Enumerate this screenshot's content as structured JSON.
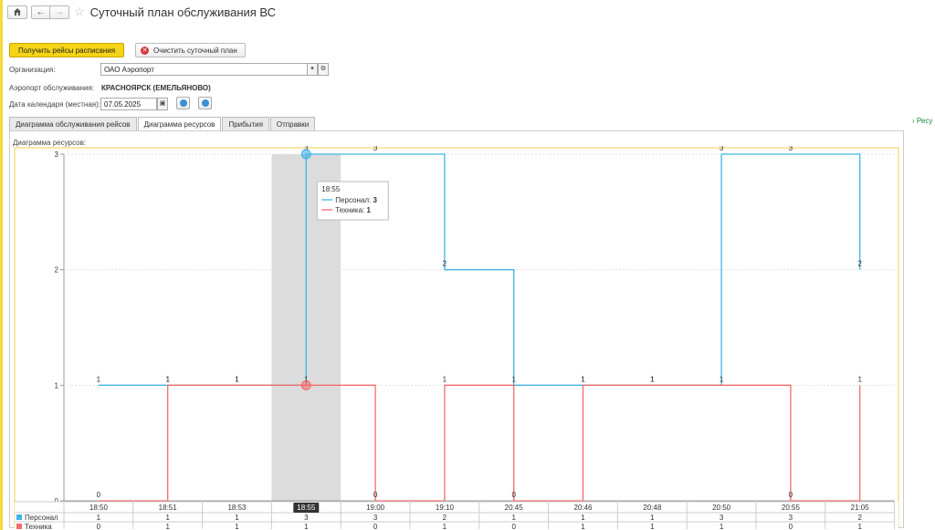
{
  "window": {
    "title": "Суточный план обслуживания ВС"
  },
  "icons": {
    "home": "home-icon",
    "back": "arrow-left-icon",
    "forward": "arrow-right-icon",
    "star": "star-icon"
  },
  "toolbar": {
    "get_flights_label": "Получить рейсы расписания",
    "clear_plan_label": "Очистить суточный план"
  },
  "form": {
    "org_label": "Организация:",
    "org_value": "ОАО Аэропорт",
    "airport_label": "Аэропорт обслуживания:",
    "airport_value": "КРАСНОЯРСК (ЕМЕЛЬЯНОВО)",
    "date_label": "Дата календаря (местная):",
    "date_value": "07.05.2025"
  },
  "tabs": [
    "Диаграмма обслуживания рейсов",
    "Диаграмма ресурсов",
    "Прибытия",
    "Отправки"
  ],
  "active_tab": 1,
  "side_link": "Ресу",
  "chart_caption": "Диаграмма ресурсов:",
  "colors": {
    "accent": "#f5d416",
    "personnel": "#3fb5e6",
    "equipment": "#f26b6b",
    "highlight": "#dcdcdc"
  },
  "chart_data": {
    "type": "line",
    "step": true,
    "categories": [
      "18:50",
      "18:51",
      "18:53",
      "18:55",
      "19:00",
      "19:10",
      "20:45",
      "20:46",
      "20:48",
      "20:50",
      "20:55",
      "21:05"
    ],
    "series": [
      {
        "name": "Персонал",
        "values": [
          1,
          1,
          1,
          3,
          3,
          2,
          1,
          1,
          1,
          3,
          3,
          2
        ]
      },
      {
        "name": "Техника",
        "values": [
          0,
          1,
          1,
          1,
          0,
          1,
          0,
          1,
          1,
          1,
          0,
          1
        ]
      }
    ],
    "ylim": [
      0,
      3
    ],
    "yticks": [
      "0",
      "1",
      "2",
      "3"
    ],
    "grid": true,
    "highlight_category": "18:55",
    "tooltip": {
      "time": "18:55",
      "rows": [
        {
          "name": "Персонал",
          "value": "3"
        },
        {
          "name": "Техника",
          "value": "1"
        }
      ]
    }
  }
}
